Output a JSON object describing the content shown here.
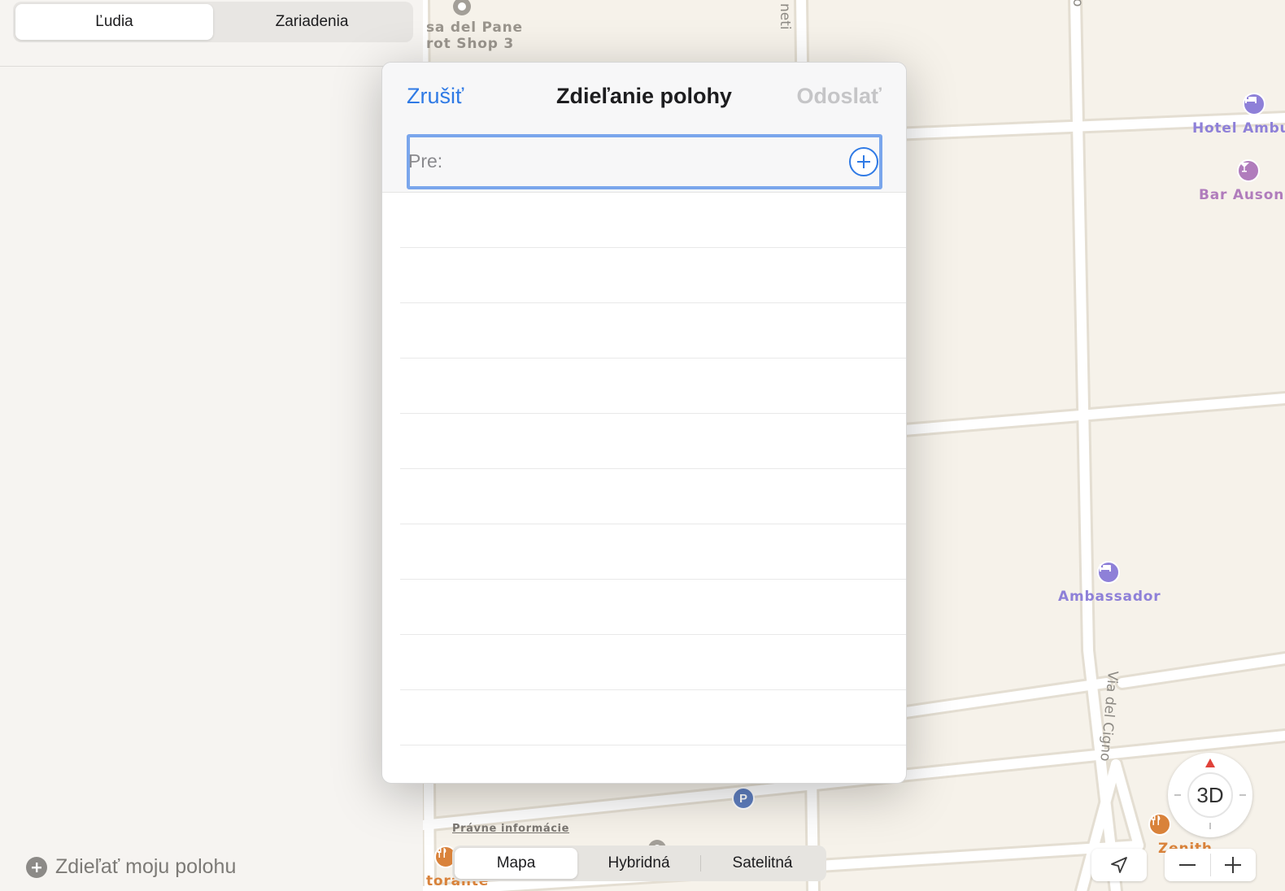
{
  "sidebar": {
    "tabs": [
      {
        "label": "Ľudia",
        "active": true
      },
      {
        "label": "Zariadenia",
        "active": false
      }
    ],
    "share_my_location": "Zdieľať moju polohu"
  },
  "map": {
    "labels": {
      "poi_top_1": "sa del Pane",
      "poi_top_2": "rot Shop 3",
      "street_top": "neti",
      "street_top_right": "o",
      "hotel_ambu": "Hotel Ambu",
      "bar_ausoni": "Bar Ausoni",
      "ambassador": "Ambassador",
      "via_del_cigno": "Via del Cigno",
      "zenith": "Zenith",
      "torante": "torante"
    },
    "legal": "Právne informácie",
    "map_types": [
      {
        "label": "Mapa",
        "active": true
      },
      {
        "label": "Hybridná",
        "active": false
      },
      {
        "label": "Satelitná",
        "active": false
      }
    ],
    "compass_label": "3D",
    "colors": {
      "background": "#f6f2ea",
      "road": "#ffffff",
      "hotel": "#8e80d8",
      "bar": "#b07cbc",
      "restaurant": "#d9823a",
      "parking": "#5f7fc0"
    }
  },
  "dialog": {
    "cancel": "Zrušiť",
    "title": "Zdieľanie polohy",
    "send": "Odoslať",
    "to_prefix": "Pre:",
    "to_value": "",
    "empty_rows": 10,
    "accent": "#2f7ae5"
  }
}
